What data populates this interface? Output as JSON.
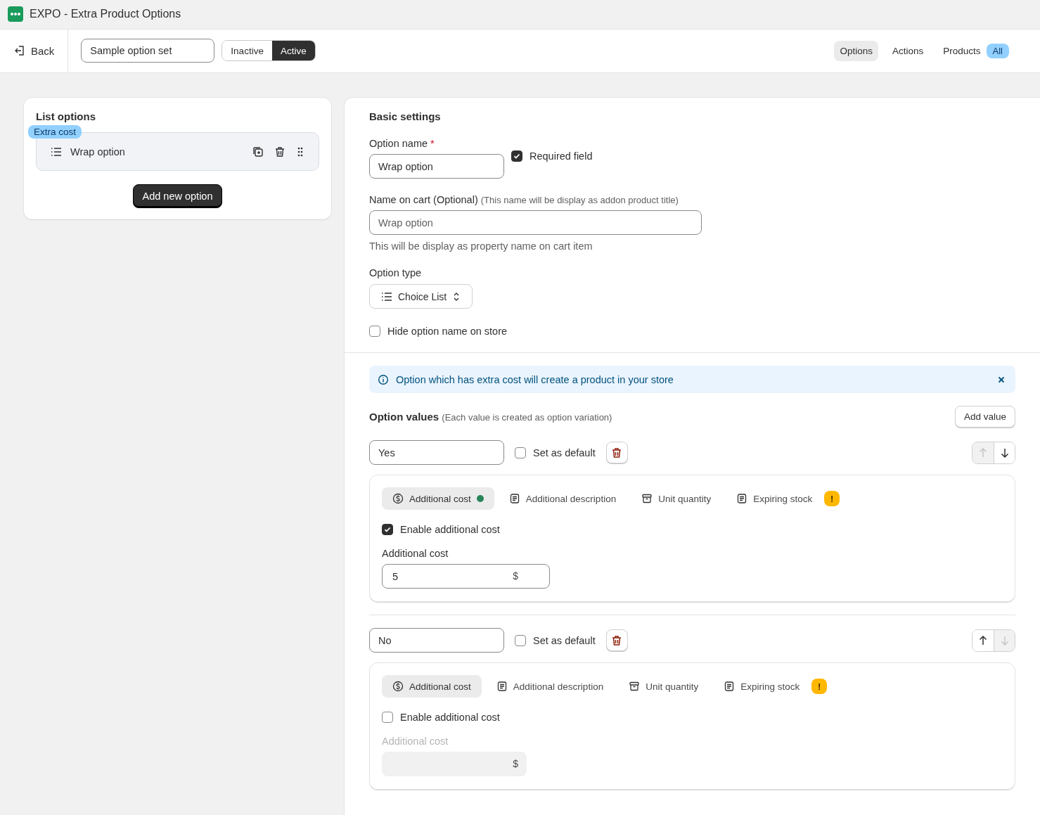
{
  "app_bar": {
    "title": "EXPO - Extra Product Options"
  },
  "toolbar": {
    "back": "Back",
    "set_name": "Sample option set",
    "status": [
      {
        "label": "Inactive",
        "selected": false
      },
      {
        "label": "Active",
        "selected": true
      }
    ],
    "nav_tabs": [
      {
        "label": "Options",
        "selected": true
      },
      {
        "label": "Actions",
        "selected": false
      },
      {
        "label": "Products",
        "selected": false,
        "badge": "All"
      }
    ]
  },
  "list_options": {
    "title": "List options",
    "items": [
      {
        "label": "Wrap option",
        "tag": "Extra cost"
      }
    ],
    "add_button": "Add new option"
  },
  "basic_settings": {
    "title": "Basic settings",
    "option_name": {
      "label": "Option name",
      "required_mark": "*",
      "value": "Wrap option"
    },
    "required_field": {
      "label": "Required field",
      "checked": true
    },
    "name_on_cart": {
      "label": "Name on cart (Optional)",
      "hint": "(This name will be display as addon product title)",
      "placeholder": "Wrap option",
      "help": "This will be display as property name on cart item"
    },
    "option_type": {
      "label": "Option type",
      "value": "Choice List"
    },
    "hide_name": {
      "label": "Hide option name on store",
      "checked": false
    }
  },
  "notice": {
    "text": "Option which has extra cost will create a product in your store"
  },
  "option_values": {
    "title": "Option values",
    "hint": "(Each value is created as option variation)",
    "add_button": "Add value",
    "values": [
      {
        "value": "Yes",
        "set_default": {
          "label": "Set as default",
          "checked": false
        },
        "up_disabled": true,
        "down_disabled": false,
        "tabs": [
          {
            "kind": "cost",
            "label": "Additional cost",
            "selected": true,
            "dot": true
          },
          {
            "kind": "description",
            "label": "Additional description",
            "selected": false
          },
          {
            "kind": "quantity",
            "label": "Unit quantity",
            "selected": false
          },
          {
            "kind": "stock",
            "label": "Expiring stock",
            "selected": false,
            "badge": "!"
          }
        ],
        "enable": {
          "label": "Enable additional cost",
          "checked": true
        },
        "cost_label": "Additional cost",
        "cost_value": "5",
        "currency": "$"
      },
      {
        "value": "No",
        "set_default": {
          "label": "Set as default",
          "checked": false
        },
        "up_disabled": false,
        "down_disabled": true,
        "tabs": [
          {
            "kind": "cost",
            "label": "Additional cost",
            "selected": true,
            "dot": false
          },
          {
            "kind": "description",
            "label": "Additional description",
            "selected": false
          },
          {
            "kind": "quantity",
            "label": "Unit quantity",
            "selected": false
          },
          {
            "kind": "stock",
            "label": "Expiring stock",
            "selected": false,
            "badge": "!"
          }
        ],
        "enable": {
          "label": "Enable additional cost",
          "checked": false
        },
        "cost_label": "Additional cost",
        "currency": "$"
      }
    ]
  }
}
